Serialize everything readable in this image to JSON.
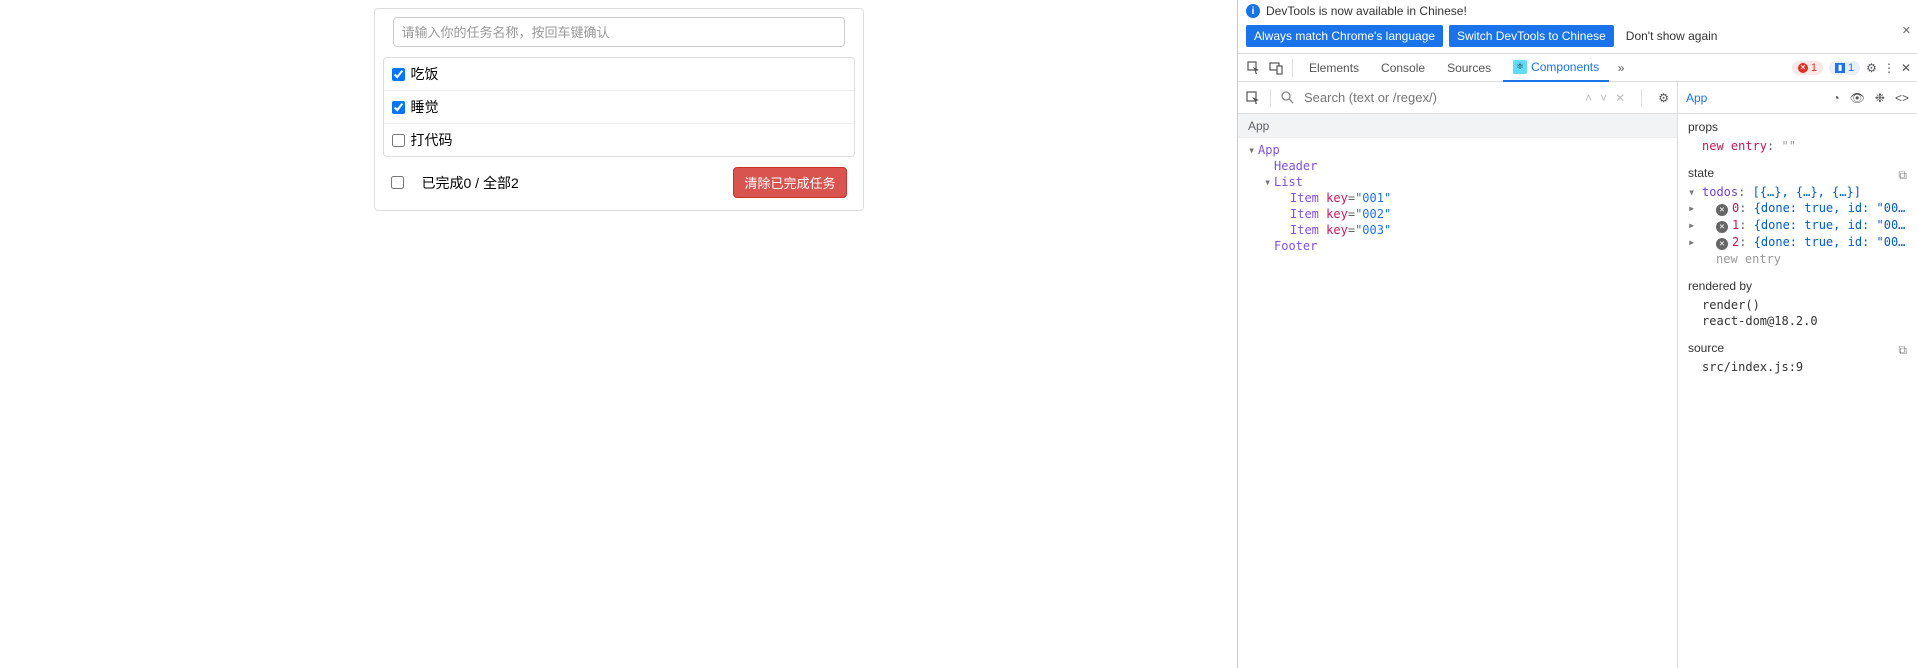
{
  "app": {
    "input_placeholder": "请输入你的任务名称，按回车键确认",
    "items": [
      {
        "label": "吃饭",
        "checked": true
      },
      {
        "label": "睡觉",
        "checked": true
      },
      {
        "label": "打代码",
        "checked": false
      }
    ],
    "footer": {
      "summary": "已完成0 / 全部2",
      "clear_label": "清除已完成任务"
    }
  },
  "devtools": {
    "banner": {
      "text": "DevTools is now available in Chinese!",
      "btn1": "Always match Chrome's language",
      "btn2": "Switch DevTools to Chinese",
      "dont_show": "Don't show again"
    },
    "tabs": {
      "elements": "Elements",
      "console": "Console",
      "sources": "Sources",
      "components": "Components",
      "err_count": "1",
      "info_count": "1"
    },
    "search_placeholder": "Search (text or /regex/)",
    "selected_component": "App",
    "breadcrumb": "App",
    "tree": {
      "app": "App",
      "header": "Header",
      "list": "List",
      "item": "Item",
      "key_attr": "key",
      "keys": [
        "001",
        "002",
        "003"
      ],
      "footer": "Footer"
    },
    "props": {
      "title": "props",
      "new_entry_key": "new entry",
      "new_entry_val": "\"\""
    },
    "state": {
      "title": "state",
      "todos_key": "todos",
      "todos_preview": "[{…}, {…}, {…}]",
      "rows": [
        "{done: true, id: \"00…",
        "{done: true, id: \"00…",
        "{done: true, id: \"00…"
      ],
      "indexes": [
        "0",
        "1",
        "2"
      ],
      "new_entry": "new entry"
    },
    "rendered_by": {
      "title": "rendered by",
      "render": "render()",
      "lib": "react-dom@18.2.0"
    },
    "source": {
      "title": "source",
      "loc": "src/index.js:9"
    }
  }
}
